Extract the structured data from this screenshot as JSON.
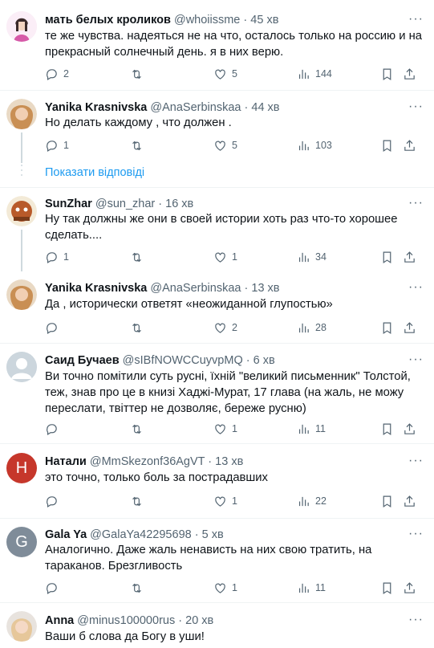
{
  "tweets": [
    {
      "name": "мать белых кроликов",
      "handle": "@whoiissme",
      "time": "45 хв",
      "text": "те же чувства. надеяться не на что, осталось только на россию и на прекрасный солнечный день. я в них верю.",
      "replies": "2",
      "retweets": "",
      "likes": "5",
      "views": "144"
    },
    {
      "name": "Yanika Krasnivska",
      "handle": "@AnaSerbinskaa",
      "time": "44 хв",
      "text": "Но делать каждому , что должен .",
      "replies": "1",
      "retweets": "",
      "likes": "5",
      "views": "103"
    },
    {
      "name": "SunZhar",
      "handle": "@sun_zhar",
      "time": "16 хв",
      "text": "Ну так должны же они в своей истории хоть раз что-то хорошее сделать....",
      "replies": "1",
      "retweets": "",
      "likes": "1",
      "views": "34"
    },
    {
      "name": "Yanika Krasnivska",
      "handle": "@AnaSerbinskaa",
      "time": "13 хв",
      "text": "Да , исторически ответят «неожиданной глупостью»",
      "replies": "",
      "retweets": "",
      "likes": "2",
      "views": "28"
    },
    {
      "name": "Саид Бучаев",
      "handle": "@sIBfNOWCCuyvpMQ",
      "time": "6 хв",
      "text": "Ви точно помітили суть русні, їхній \"великий письменник\" Толстой, теж, знав про це в книзі Хаджі-Мурат, 17 глава (на жаль, не можу переслати, твіттер не дозволяє, береже русню)",
      "replies": "",
      "retweets": "",
      "likes": "1",
      "views": "11"
    },
    {
      "name": "Натали",
      "handle": "@MmSkezonf36AgVT",
      "time": "13 хв",
      "avatar_letter": "H",
      "text": "это точно, только боль за пострадавших",
      "replies": "",
      "retweets": "",
      "likes": "1",
      "views": "22"
    },
    {
      "name": "Gala Ya",
      "handle": "@GalaYa42295698",
      "time": "5 хв",
      "avatar_letter": "G",
      "text": "Аналогично. Даже жаль ненависть на них свою тратить, на тараканов. Брезгливость",
      "replies": "",
      "retweets": "",
      "likes": "1",
      "views": "11"
    },
    {
      "name": "Anna",
      "handle": "@minus100000rus",
      "time": "20 хв",
      "text": "Ваши б слова да Богу в уши!",
      "replies": "",
      "retweets": "",
      "likes": "",
      "views": ""
    }
  ],
  "show_replies_label": "Показати відповіді",
  "dot": "·",
  "colors": {
    "accent": "#1d9bf0",
    "secondary_text": "#536471",
    "avatar_natali": "#c6372b",
    "avatar_gala": "#7f8c99"
  }
}
